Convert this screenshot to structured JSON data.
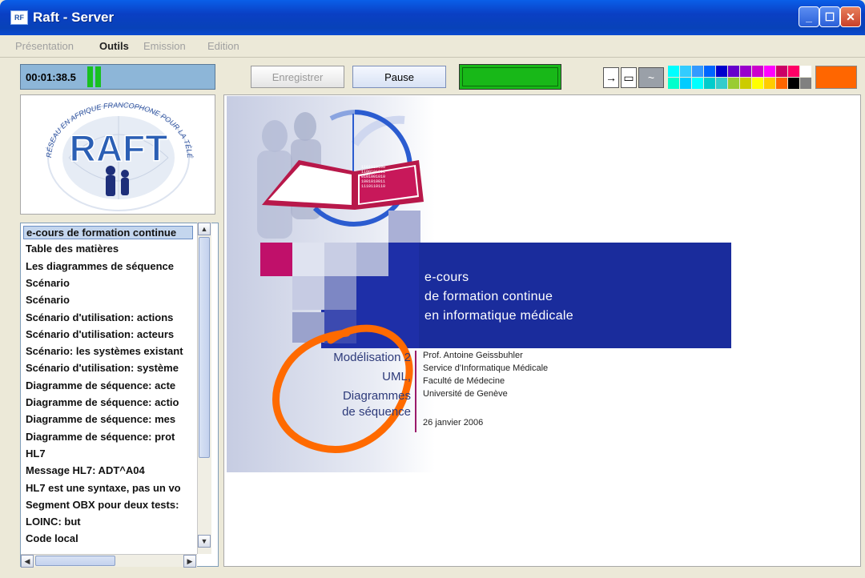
{
  "window": {
    "title": "Raft - Server",
    "icon_text": "RF"
  },
  "menu": [
    "Présentation",
    "Outils",
    "Emission",
    "Edition"
  ],
  "toolbar": {
    "timer": "00:01:38.5",
    "record_label": "Enregistrer",
    "pause_label": "Pause",
    "arrow_icon": "→",
    "rect_icon": "▭",
    "pen_icon": "~"
  },
  "palette": {
    "row1": [
      "#00FFFF",
      "#33CCFF",
      "#3399FF",
      "#0066FF",
      "#0000CC",
      "#6600CC",
      "#9900CC",
      "#CC00CC",
      "#FF00FF",
      "#CC0066",
      "#FF0066",
      "#FFFFFF"
    ],
    "row2": [
      "#00FFCC",
      "#00CCFF",
      "#00FFFF",
      "#00CCCC",
      "#33CCCC",
      "#99CC33",
      "#CCCC00",
      "#FFFF00",
      "#FFCC00",
      "#FF6600",
      "#000000",
      "#808080"
    ],
    "selected_color": "#FF6600"
  },
  "slides": [
    "e-cours de formation continue",
    "Table des matières",
    "Les diagrammes de séquence",
    "Scénario",
    "Scénario",
    "Scénario d'utilisation: actions",
    "Scénario d'utilisation: acteurs",
    "Scénario: les systèmes existant",
    "Scénario d'utilisation: système",
    "Diagramme de séquence: acte",
    "Diagramme de séquence: actio",
    "Diagramme de séquence: mes",
    "Diagramme de séquence: prot",
    "HL7",
    "Message HL7: ADT^A04",
    "HL7 est une syntaxe, pas un vo",
    "Segment OBX pour deux tests:",
    "LOINC: but",
    "Code local"
  ],
  "slide": {
    "banner_line1": "e-cours",
    "banner_line2": "de formation continue",
    "banner_line3": "en informatique médicale",
    "left_line1": "Modélisation 2",
    "left_line2": "UML,",
    "left_line3": "Diagrammes",
    "left_line4": "de séquence",
    "author": "Prof. Antoine Geissbuhler",
    "dept": "Service d'Informatique Médicale",
    "faculty": "Faculté de Médecine",
    "university": "Université de Genève",
    "date": "26 janvier 2006",
    "book_text": "1101010100\n1100101011\n0101001010\n1001010011\n1110110110"
  },
  "logo": {
    "text": "RAFT",
    "ring_text": "RÉSEAU EN AFRIQUE FRANCOPHONE POUR LA TÉLÉMÉDECINE"
  },
  "colors": {
    "banner_blue": "#1E2FA8",
    "magenta": "#C0106A",
    "annotation_orange": "#FF6A00"
  }
}
